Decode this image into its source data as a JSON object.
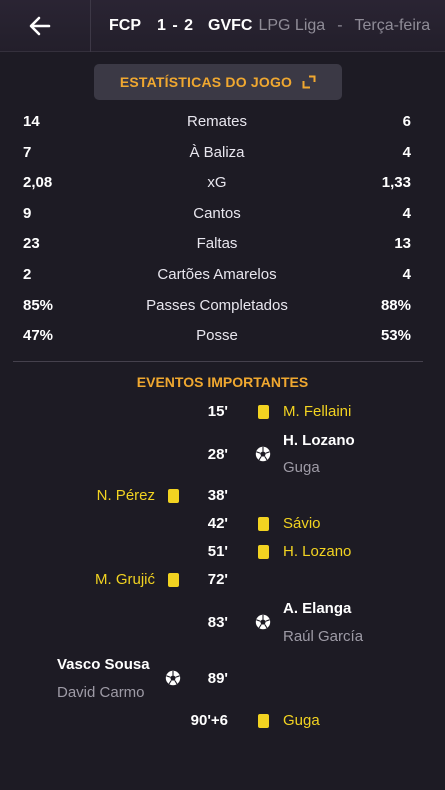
{
  "header": {
    "home_team": "FCP",
    "score": "1 - 2",
    "away_team": "GVFC",
    "competition": "LPG Liga",
    "separator": "-",
    "day": "Terça-feira"
  },
  "stats": {
    "title": "ESTATÍSTICAS DO JOGO",
    "rows": [
      {
        "home": "14",
        "label": "Remates",
        "away": "6"
      },
      {
        "home": "7",
        "label": "À Baliza",
        "away": "4"
      },
      {
        "home": "2,08",
        "label": "xG",
        "away": "1,33"
      },
      {
        "home": "9",
        "label": "Cantos",
        "away": "4"
      },
      {
        "home": "23",
        "label": "Faltas",
        "away": "13"
      },
      {
        "home": "2",
        "label": "Cartões Amarelos",
        "away": "4"
      },
      {
        "home": "85%",
        "label": "Passes Completados",
        "away": "88%"
      },
      {
        "home": "47%",
        "label": "Posse",
        "away": "53%"
      }
    ]
  },
  "events": {
    "title": "EVENTOS IMPORTANTES",
    "items": [
      {
        "minute": "15'",
        "side": "away",
        "type": "yellow-card",
        "player": "M. Fellaini"
      },
      {
        "minute": "28'",
        "side": "away",
        "type": "goal",
        "player": "H. Lozano",
        "assist": "Guga"
      },
      {
        "minute": "38'",
        "side": "home",
        "type": "yellow-card",
        "player": "N. Pérez"
      },
      {
        "minute": "42'",
        "side": "away",
        "type": "yellow-card",
        "player": "Sávio"
      },
      {
        "minute": "51'",
        "side": "away",
        "type": "yellow-card",
        "player": "H. Lozano"
      },
      {
        "minute": "72'",
        "side": "home",
        "type": "yellow-card",
        "player": "M. Grujić"
      },
      {
        "minute": "83'",
        "side": "away",
        "type": "goal",
        "player": "A. Elanga",
        "assist": "Raúl García"
      },
      {
        "minute": "89'",
        "side": "home",
        "type": "goal",
        "player": "Vasco Sousa",
        "assist": "David Carmo"
      },
      {
        "minute": "90'+6",
        "side": "away",
        "type": "yellow-card",
        "player": "Guga"
      }
    ]
  },
  "icons": {
    "back": "arrow-left-icon",
    "expand": "expand-icon",
    "yellow_card": "yellow-card-icon",
    "goal": "football-icon"
  },
  "colors": {
    "accent": "#f0a830",
    "yellow_card": "#f2d321",
    "background": "#1d1b24"
  }
}
